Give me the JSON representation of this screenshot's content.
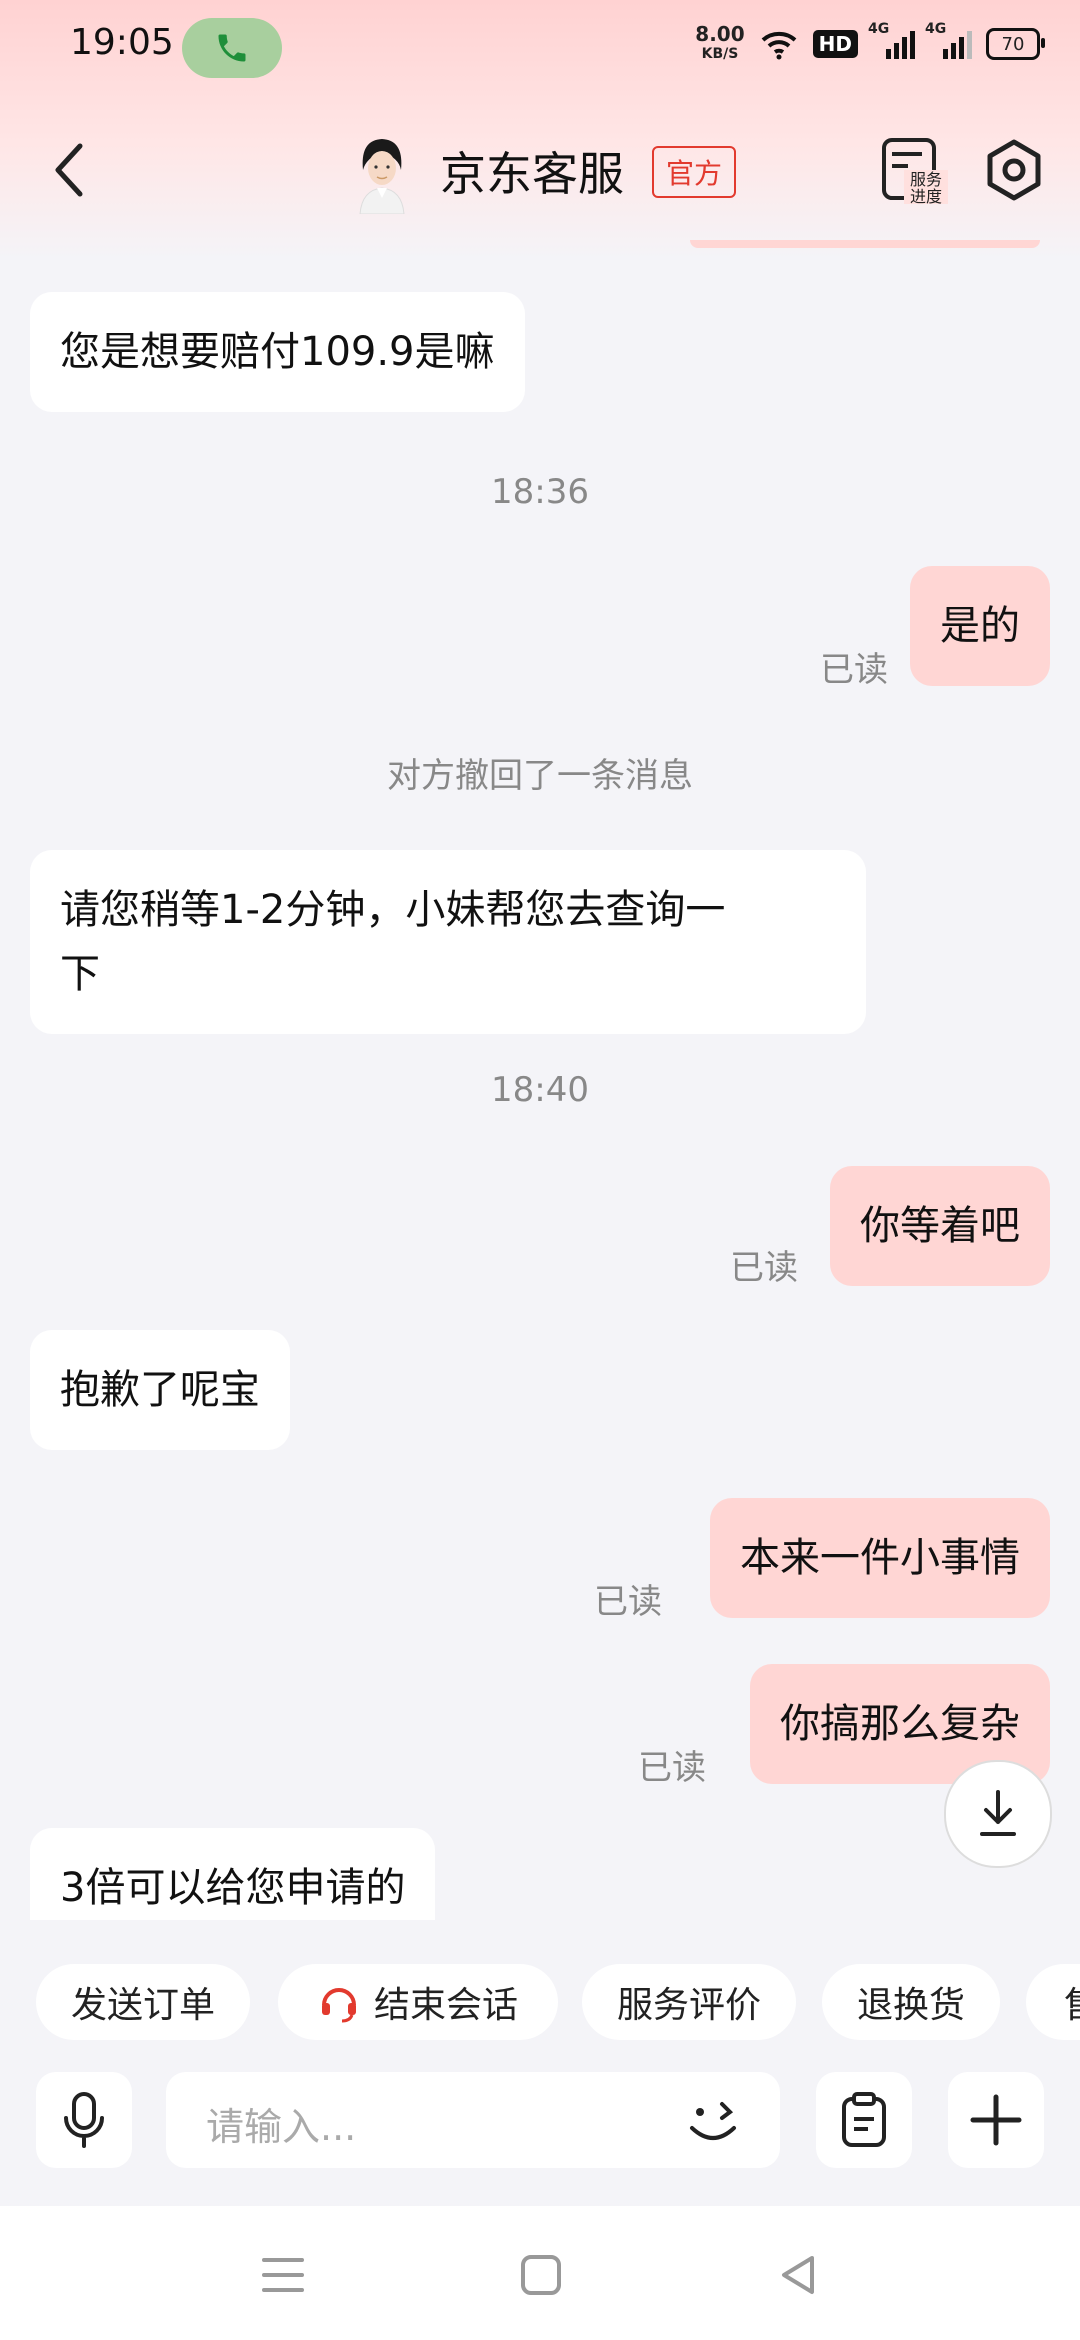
{
  "status_bar": {
    "time": "19:05",
    "net_speed_value": "8.00",
    "net_speed_unit": "KB/S",
    "hd": "HD",
    "sim1": "4G",
    "sim2": "4G",
    "battery": "70"
  },
  "header": {
    "agent_name": "京东客服",
    "official_badge": "官方",
    "service_progress_label_1": "服务",
    "service_progress_label_2": "进度"
  },
  "messages": [
    {
      "side": "in",
      "text": "您是想要赔付109.9是嘛"
    },
    {
      "kind": "time",
      "text": "18:36"
    },
    {
      "side": "out",
      "text": "是的",
      "status": "已读"
    },
    {
      "kind": "system",
      "text": "对方撤回了一条消息"
    },
    {
      "side": "in",
      "text": "请您稍等1-2分钟，小妹帮您去查询一\n下"
    },
    {
      "kind": "time",
      "text": "18:40"
    },
    {
      "side": "out",
      "text": "你等着吧",
      "status": "已读"
    },
    {
      "side": "in",
      "text": "抱歉了呢宝"
    },
    {
      "side": "out",
      "text": "本来一件小事情",
      "status": "已读"
    },
    {
      "side": "out",
      "text": "你搞那么复杂",
      "status": "已读"
    },
    {
      "side": "in",
      "text": "3倍可以给您申请的"
    }
  ],
  "quick_actions": [
    "发送订单",
    "结束会话",
    "服务评价",
    "退换货",
    "售"
  ],
  "input": {
    "placeholder": "请输入..."
  },
  "colors": {
    "accent": "#e23a2e",
    "outgoing_bubble": "#ffd6d4",
    "background": "#f4f4f8"
  }
}
